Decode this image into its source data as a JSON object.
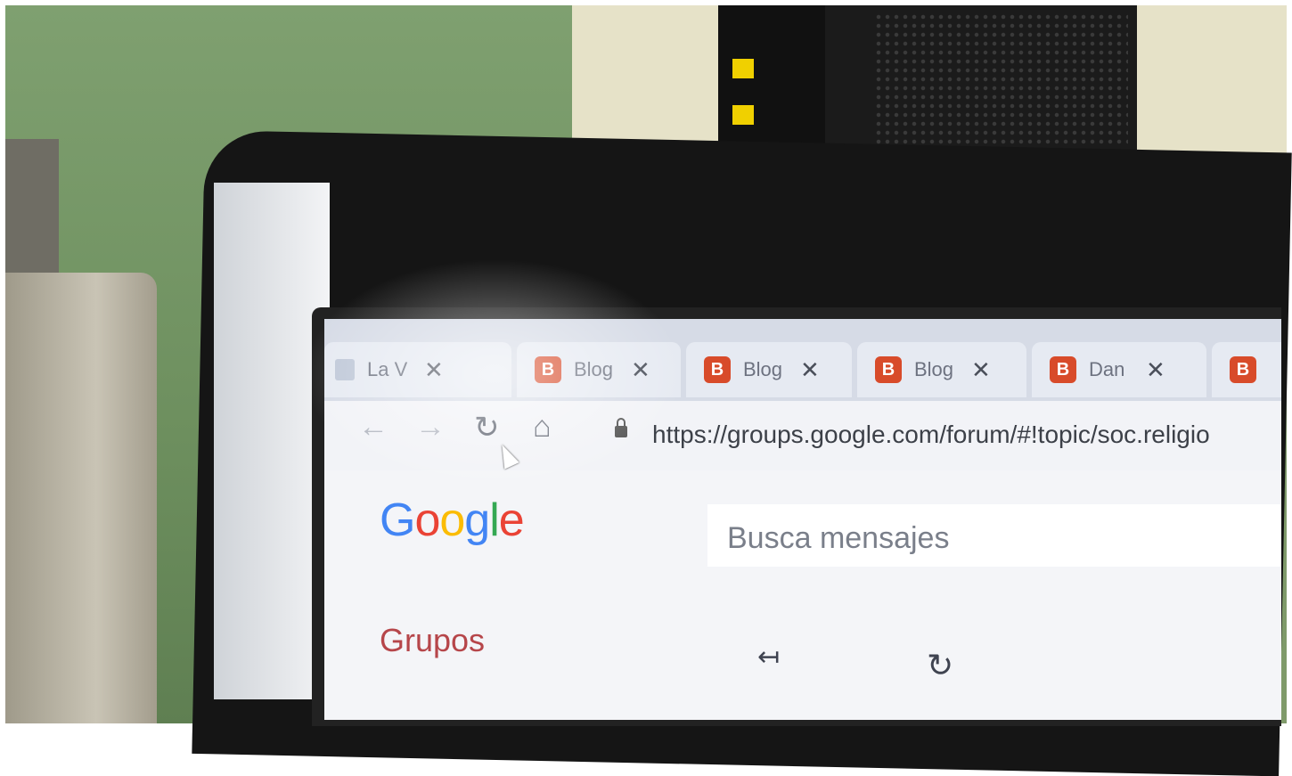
{
  "browser": {
    "tabs": [
      {
        "label": "La V",
        "icon": "page-icon"
      },
      {
        "label": "Blog",
        "icon": "blogger-icon"
      },
      {
        "label": "Blog",
        "icon": "blogger-icon"
      },
      {
        "label": "Blog",
        "icon": "blogger-icon"
      },
      {
        "label": "Dan",
        "icon": "blogger-icon"
      },
      {
        "label": "",
        "icon": "blogger-icon"
      }
    ],
    "tab_close_glyph": "✕",
    "favicon_letter": "B",
    "url": "https://groups.google.com/forum/#!topic/soc.religio"
  },
  "page": {
    "logo": {
      "letters": [
        "G",
        "o",
        "o",
        "g",
        "l",
        "e"
      ],
      "colors": [
        "#4285f4",
        "#ea4335",
        "#fbbc05",
        "#4285f4",
        "#34a853",
        "#ea4335"
      ]
    },
    "search_placeholder": "Busca mensajes",
    "grupos_label": "Grupos"
  },
  "icons": {
    "back": "←",
    "forward": "→",
    "reload": "↻",
    "home": "⌂",
    "reply": "↤",
    "refresh": "↻"
  }
}
